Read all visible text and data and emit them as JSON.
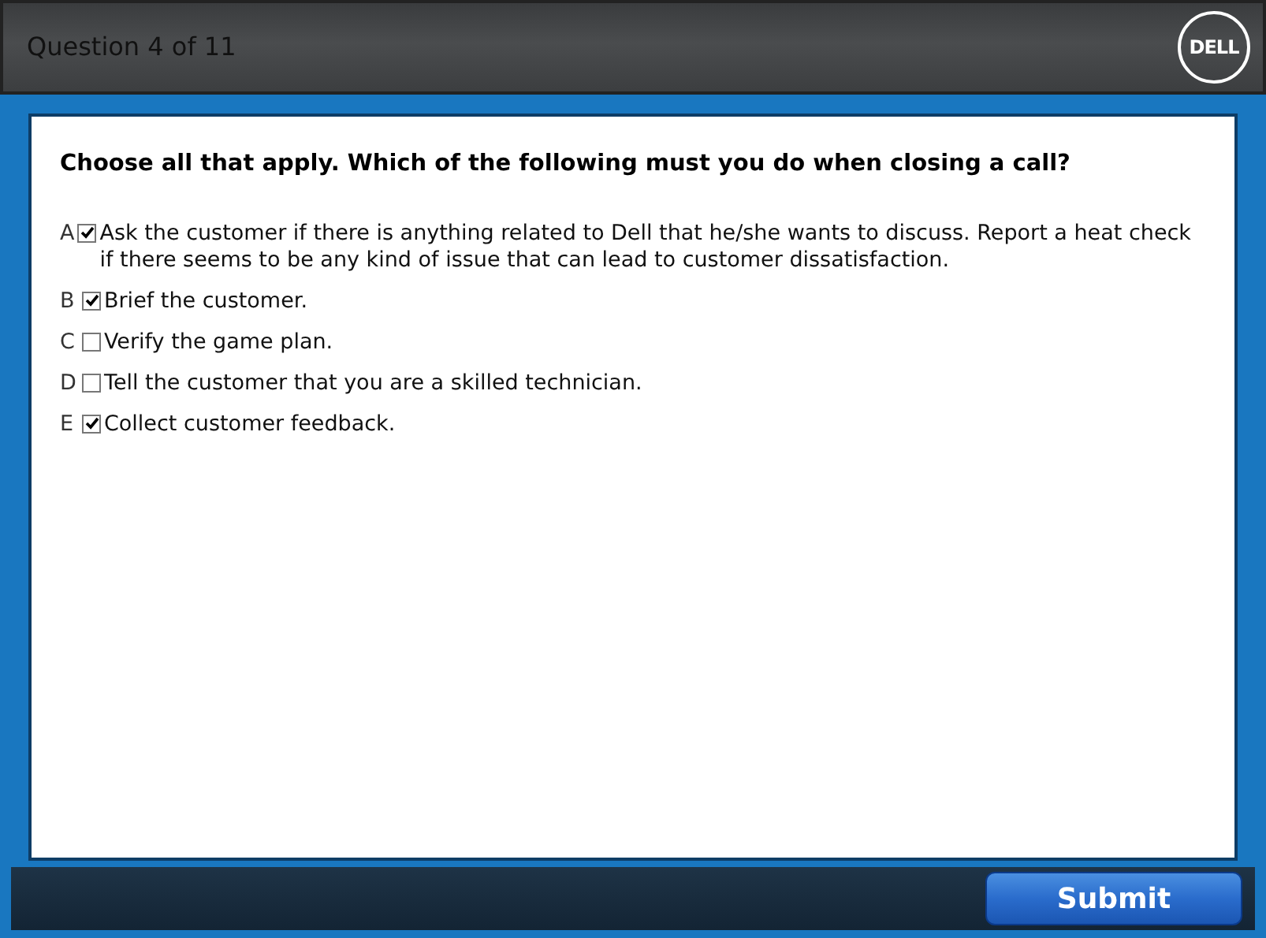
{
  "header": {
    "title": "Question 4 of 11",
    "logo": "DELL"
  },
  "question": "Choose all that apply. Which of the following must you do when closing a call?",
  "options": [
    {
      "letter": "A",
      "checked": true,
      "text": "Ask the customer if there is anything related to Dell that he/she wants to discuss. Report a heat check if there seems to be any kind of issue that can lead to customer dissatisfaction."
    },
    {
      "letter": "B",
      "checked": true,
      "text": "Brief the customer."
    },
    {
      "letter": "C",
      "checked": false,
      "text": "Verify the game plan."
    },
    {
      "letter": "D",
      "checked": false,
      "text": "Tell the customer that you are a skilled technician."
    },
    {
      "letter": "E",
      "checked": true,
      "text": "Collect customer feedback."
    }
  ],
  "submit": "Submit"
}
